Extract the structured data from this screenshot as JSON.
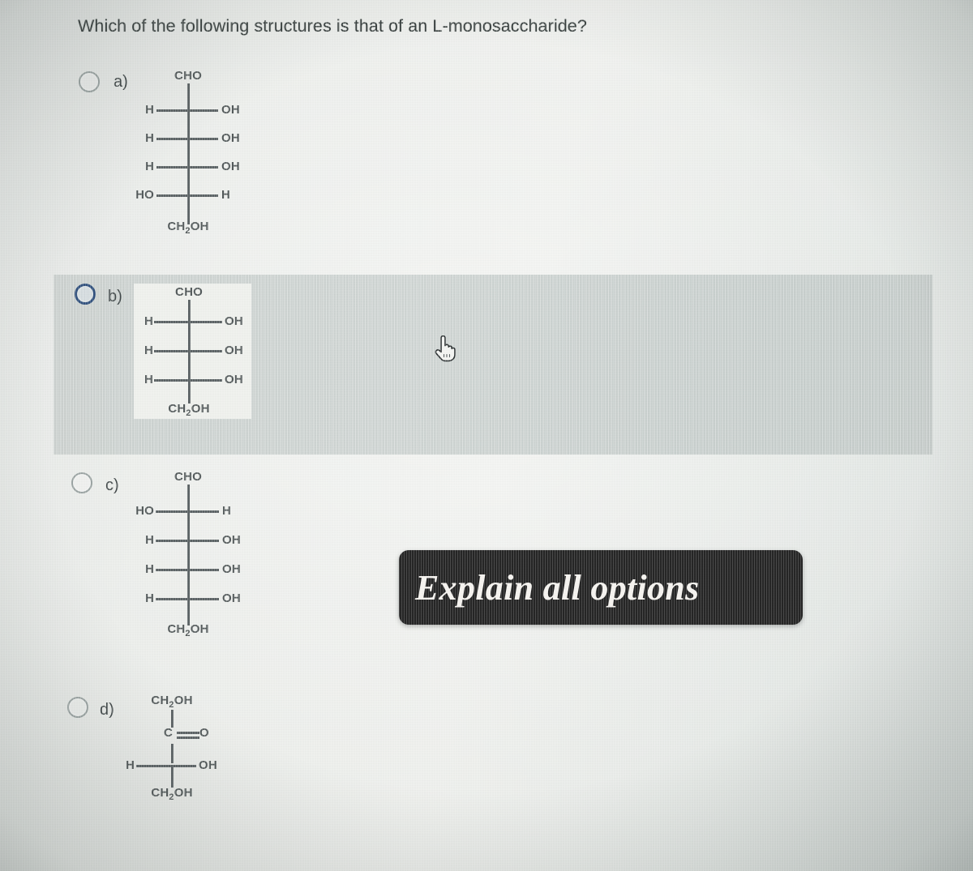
{
  "question": {
    "text": "Which of the following structures is that of an L-monosaccharide?"
  },
  "options": [
    {
      "letter": "a)",
      "selected": false,
      "highlighted": false,
      "structure": {
        "top": "CHO",
        "bottom": "CH2OH",
        "rungs": [
          {
            "left": "H",
            "right": "OH"
          },
          {
            "left": "H",
            "right": "OH"
          },
          {
            "left": "H",
            "right": "OH"
          },
          {
            "left": "HO",
            "right": "H"
          }
        ]
      }
    },
    {
      "letter": "b)",
      "selected": false,
      "highlighted": true,
      "structure": {
        "top": "CHO",
        "bottom": "CH2OH",
        "rungs": [
          {
            "left": "H",
            "right": "OH"
          },
          {
            "left": "H",
            "right": "OH"
          },
          {
            "left": "H",
            "right": "OH"
          }
        ]
      }
    },
    {
      "letter": "c)",
      "selected": false,
      "highlighted": false,
      "structure": {
        "top": "CHO",
        "bottom": "CH2OH",
        "rungs": [
          {
            "left": "HO",
            "right": "H"
          },
          {
            "left": "H",
            "right": "OH"
          },
          {
            "left": "H",
            "right": "OH"
          },
          {
            "left": "H",
            "right": "OH"
          }
        ]
      }
    },
    {
      "letter": "d)",
      "selected": false,
      "highlighted": false,
      "structure": {
        "top": "CH2OH",
        "carbonyl": "C=O",
        "bottom": "CH2OH",
        "rungs": [
          {
            "left": "H",
            "right": "OH"
          }
        ]
      }
    }
  ],
  "overlay": {
    "explain_label": "Explain all options"
  },
  "cursor": {
    "icon": "pointing-hand-cursor"
  },
  "colors": {
    "page_background": "#e2e5e1",
    "highlight_band": "#c9cfcd",
    "overlay_background": "#262626",
    "overlay_text": "#f4f2ee",
    "focus_ring": "#33527e",
    "structure_line": "#5c6365",
    "text": "#39403f"
  }
}
